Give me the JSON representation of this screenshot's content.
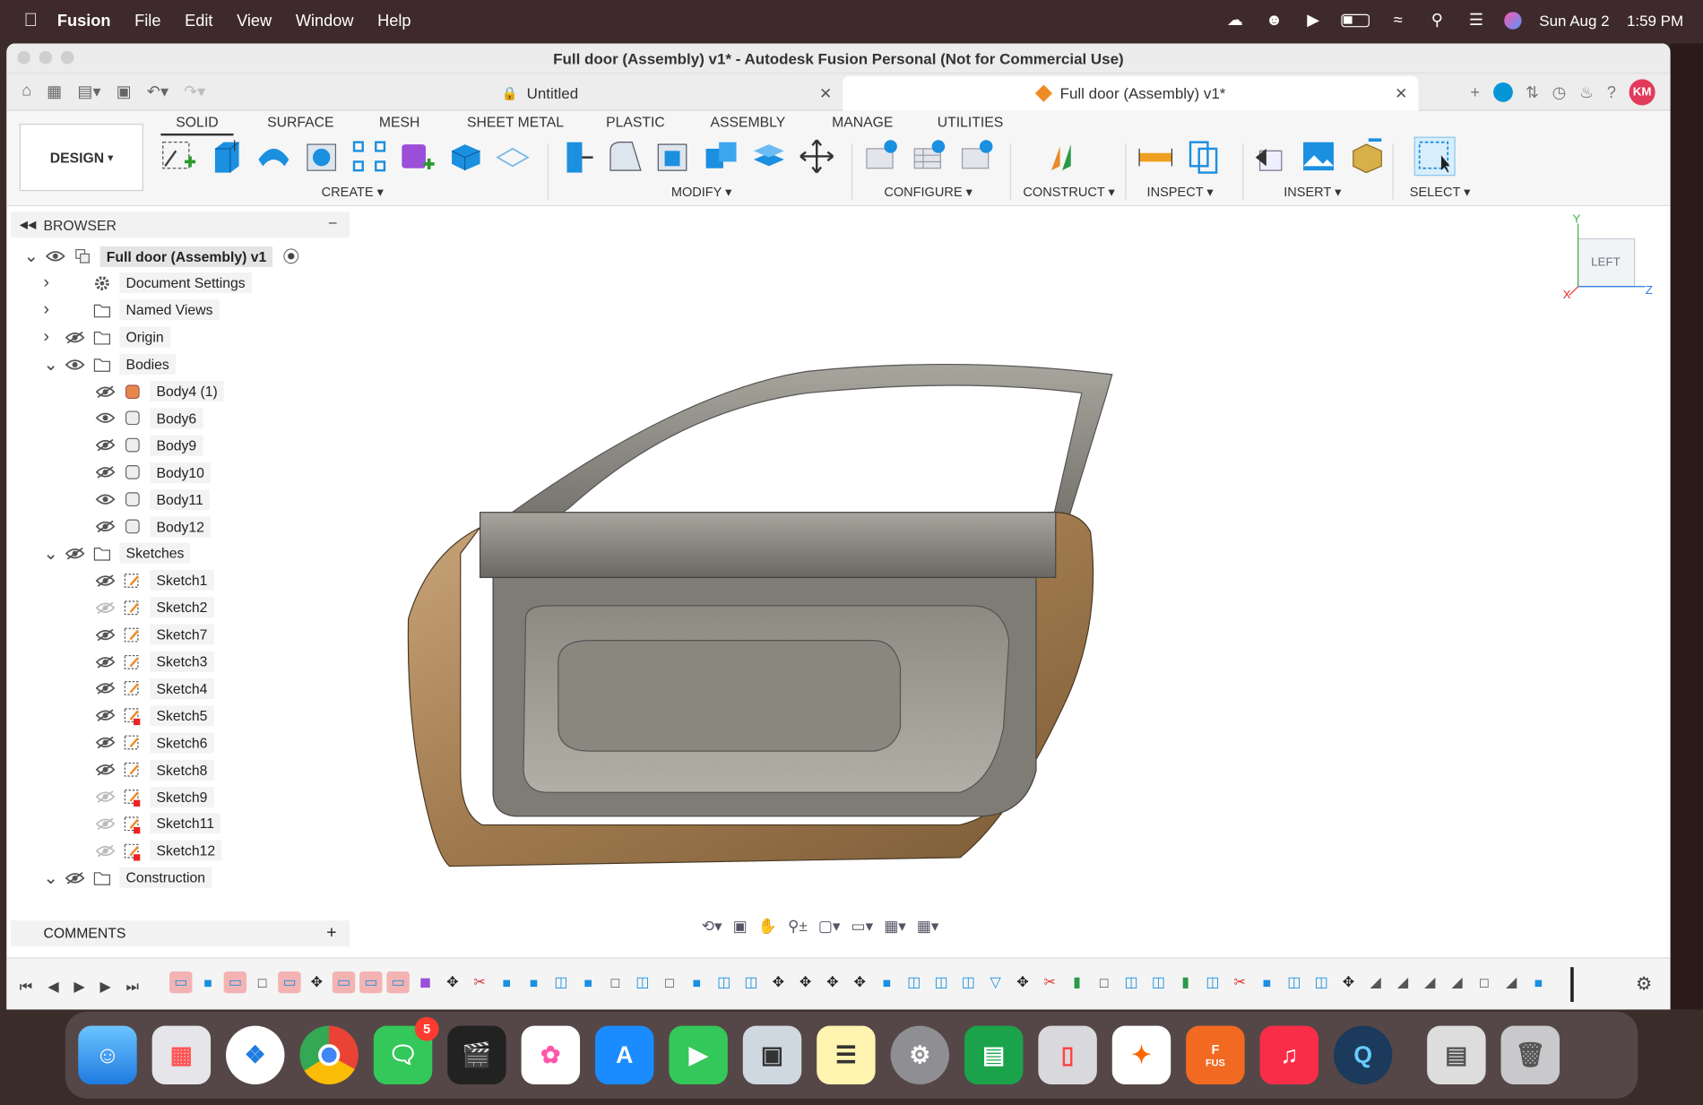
{
  "menubar": {
    "app": "Fusion",
    "menus": [
      "File",
      "Edit",
      "View",
      "Window",
      "Help"
    ],
    "date": "Sun Aug 2",
    "time": "1:59 PM"
  },
  "window": {
    "title": "Full door (Assembly) v1* - Autodesk Fusion Personal (Not for Commercial Use)"
  },
  "tabs": [
    {
      "label": "Untitled"
    },
    {
      "label": "Full door (Assembly) v1*"
    }
  ],
  "user": {
    "initials": "KM"
  },
  "ribbon": {
    "workspace": "DESIGN",
    "tabs": [
      "SOLID",
      "SURFACE",
      "MESH",
      "SHEET METAL",
      "PLASTIC",
      "ASSEMBLY",
      "MANAGE",
      "UTILITIES"
    ],
    "groups": [
      "CREATE",
      "MODIFY",
      "CONFIGURE",
      "CONSTRUCT",
      "INSPECT",
      "INSERT",
      "SELECT"
    ]
  },
  "browser": {
    "title": "BROWSER",
    "root": "Full door (Assembly) v1",
    "items": [
      {
        "label": "Document Settings",
        "icon": "gear-icon"
      },
      {
        "label": "Named Views",
        "icon": "folder-icon"
      },
      {
        "label": "Origin",
        "icon": "folder-icon"
      },
      {
        "label": "Bodies",
        "icon": "folder-icon"
      },
      {
        "label": "Body4 (1)",
        "icon": "body-icon"
      },
      {
        "label": "Body6",
        "icon": "body-icon"
      },
      {
        "label": "Body9",
        "icon": "body-icon"
      },
      {
        "label": "Body10",
        "icon": "body-icon"
      },
      {
        "label": "Body11",
        "icon": "body-icon"
      },
      {
        "label": "Body12",
        "icon": "body-icon"
      },
      {
        "label": "Sketches",
        "icon": "folder-icon"
      },
      {
        "label": "Sketch1",
        "icon": "sketch-icon"
      },
      {
        "label": "Sketch2",
        "icon": "sketch-icon"
      },
      {
        "label": "Sketch7",
        "icon": "sketch-icon"
      },
      {
        "label": "Sketch3",
        "icon": "sketch-icon"
      },
      {
        "label": "Sketch4",
        "icon": "sketch-icon"
      },
      {
        "label": "Sketch5",
        "icon": "sketch-locked-icon"
      },
      {
        "label": "Sketch6",
        "icon": "sketch-icon"
      },
      {
        "label": "Sketch8",
        "icon": "sketch-icon"
      },
      {
        "label": "Sketch9",
        "icon": "sketch-locked-icon"
      },
      {
        "label": "Sketch11",
        "icon": "sketch-locked-icon"
      },
      {
        "label": "Sketch12",
        "icon": "sketch-locked-icon"
      },
      {
        "label": "Construction",
        "icon": "folder-icon"
      }
    ]
  },
  "comments": {
    "title": "COMMENTS"
  },
  "viewcube": {
    "face": "LEFT",
    "axes": [
      "Y",
      "X",
      "Z"
    ]
  },
  "dock": {
    "messages_badge": "5",
    "fusion_label": "FUS"
  },
  "colors": {
    "accent": "#0696d7",
    "menubar": "#3e2a2c",
    "avatar": "#e23a5a"
  }
}
